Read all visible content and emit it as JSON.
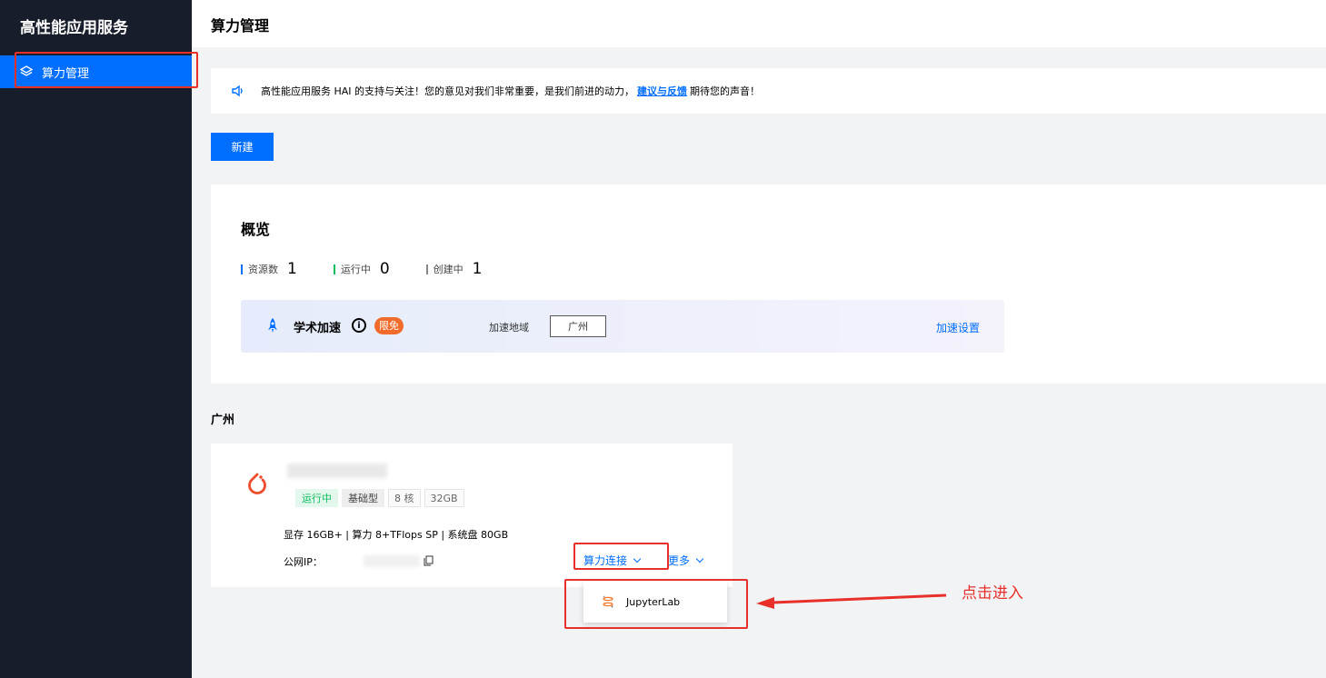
{
  "sidebar": {
    "brand": "高性能应用服务",
    "items": [
      {
        "label": "算力管理",
        "icon": "layers-icon"
      }
    ]
  },
  "header": {
    "title": "算力管理"
  },
  "notice": {
    "icon": "speaker-icon",
    "text_before": "高性能应用服务 HAI 的支持与关注！您的意见对我们非常重要，是我们前进的动力，",
    "link": "建议与反馈",
    "text_after": "期待您的声音！"
  },
  "toolbar": {
    "new_label": "新建"
  },
  "overview": {
    "title": "概览",
    "stats": [
      {
        "label": "资源数",
        "value": "1",
        "color": "#006eff"
      },
      {
        "label": "运行中",
        "value": "0",
        "color": "#0abf5b"
      },
      {
        "label": "创建中",
        "value": "1",
        "color": "#888888"
      }
    ],
    "accel": {
      "name": "学术加速",
      "info": "i",
      "badge": "限免",
      "region_label": "加速地域",
      "region_value": "广州",
      "settings": "加速设置"
    }
  },
  "region": {
    "title": "广州"
  },
  "instance": {
    "tags": [
      "运行中",
      "基础型",
      "8 核",
      "32GB"
    ],
    "specs": "显存 16GB+ | 算力 8+TFlops SP | 系统盘 80GB",
    "ip_label": "公网IP：",
    "connect": "算力连接",
    "more": "更多"
  },
  "dropdown": {
    "items": [
      {
        "label": "JupyterLab",
        "icon": "jupyter-icon"
      }
    ]
  },
  "annotation": {
    "text": "点击进入",
    "color": "#e8302a"
  }
}
